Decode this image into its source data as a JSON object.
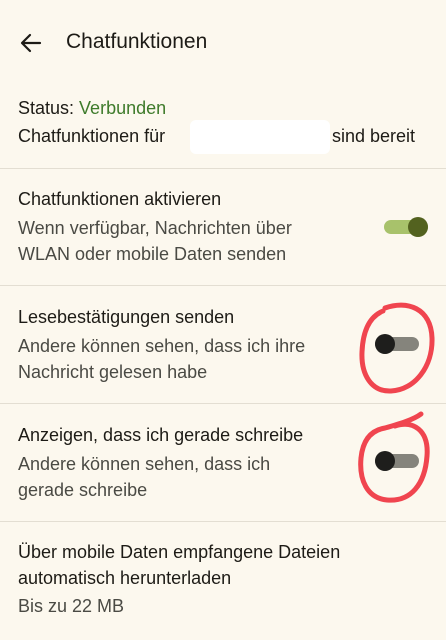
{
  "header": {
    "title": "Chatfunktionen"
  },
  "status": {
    "label": "Status:",
    "value": "Verbunden",
    "detail_prefix": "Chatfunktionen für",
    "detail_suffix": "sind bereit"
  },
  "settings": [
    {
      "title": "Chatfunktionen aktivieren",
      "summary_line1": "Wenn verfügbar, Nachrichten über",
      "summary_line2": "WLAN oder mobile Daten senden",
      "toggle": "on"
    },
    {
      "title": "Lesebestätigungen senden",
      "summary_line1": "Andere können sehen, dass ich ihre",
      "summary_line2": "Nachricht gelesen habe",
      "toggle": "off"
    },
    {
      "title": "Anzeigen, dass ich gerade schreibe",
      "summary_line1": "Andere können sehen, dass ich",
      "summary_line2": "gerade schreibe",
      "toggle": "off"
    },
    {
      "title_line1": "Über mobile Daten empfangene Dateien",
      "title_line2": "automatisch herunterladen",
      "summary": "Bis zu 22 MB"
    }
  ],
  "colors": {
    "background": "#fcf8ee",
    "status_green": "#3e7b2b",
    "toggle_on_track": "#a8c26b",
    "toggle_on_thumb": "#53621f",
    "toggle_off_track": "#85847c",
    "toggle_off_thumb": "#1e1e1c",
    "annotation_red": "#f0454f"
  },
  "icons": {
    "back": "arrow-back-icon"
  }
}
